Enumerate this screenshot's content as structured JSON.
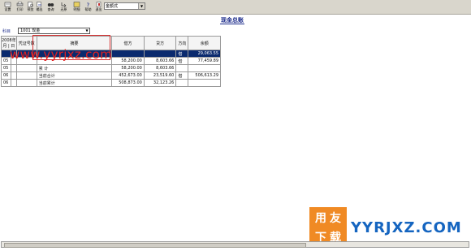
{
  "toolbar": {
    "buttons": [
      {
        "label": "设置",
        "icon": "settings-icon"
      },
      {
        "label": "打印",
        "icon": "print-icon"
      },
      {
        "label": "预览",
        "icon": "preview-icon"
      },
      {
        "label": "输出",
        "icon": "export-icon"
      },
      {
        "label": "查询",
        "icon": "binoculars-icon"
      },
      {
        "label": "还原",
        "icon": "restore-icon"
      },
      {
        "label": "明细",
        "icon": "detail-icon"
      },
      {
        "label": "帮助",
        "icon": "help-icon"
      },
      {
        "label": "退出",
        "icon": "exit-icon"
      }
    ],
    "format_select": "金额式"
  },
  "title": "现金总账",
  "subject": {
    "label": "科目",
    "value": "1001 现金"
  },
  "table": {
    "headers": {
      "year": "2008年",
      "month": "月",
      "day": "日",
      "voucher": "凭证号数",
      "summary": "摘要",
      "debit": "借方",
      "credit": "贷方",
      "direction": "方向",
      "balance": "余额"
    },
    "rows": [
      {
        "m": "",
        "d": "",
        "v": "",
        "s": "",
        "debit": "",
        "credit": "",
        "dir": "借",
        "bal": "29,063.55"
      },
      {
        "m": "05",
        "d": "",
        "v": "",
        "s": "",
        "debit": "58,200.00",
        "credit": "8,603.66",
        "dir": "借",
        "bal": "77,459.89"
      },
      {
        "m": "05",
        "d": "",
        "v": "",
        "s": "累    计",
        "debit": "58,200.00",
        "credit": "8,603.66",
        "dir": "",
        "bal": ""
      },
      {
        "m": "06",
        "d": "",
        "v": "",
        "s": "当前合计",
        "debit": "452,673.00",
        "credit": "23,519.60",
        "dir": "借",
        "bal": "506,613.29"
      },
      {
        "m": "06",
        "d": "",
        "v": "",
        "s": "当前累计",
        "debit": "508,873.00",
        "credit": "32,123.26",
        "dir": "",
        "bal": ""
      }
    ]
  },
  "watermark": "www.yyrjxz.com",
  "logo": {
    "chars": [
      "用",
      "友",
      "下",
      "载"
    ],
    "text": "YYRJXZ.COM",
    "color": "#f08a24",
    "text_color": "#1565c0"
  },
  "colors": {
    "toolbar": "#d9d6cc",
    "title": "#1a2a8a",
    "selected_row": "#0a2a6e",
    "highlight_box": "#d83030"
  }
}
